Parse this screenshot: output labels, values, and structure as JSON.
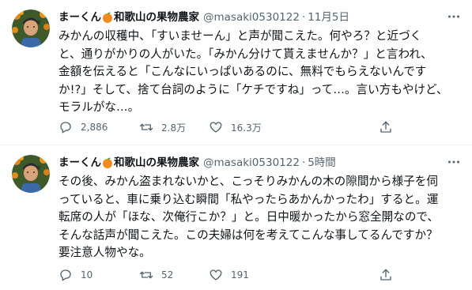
{
  "colors": {
    "text_primary": "#0f1419",
    "text_secondary": "#536471",
    "divider": "#eff3f4",
    "emoji_orange": "#f08a1c"
  },
  "tweets": [
    {
      "display_name": "まーくん",
      "display_name_suffix": "和歌山の果物農家",
      "handle": "@masaki0530122",
      "separator": "·",
      "time": "11月5日",
      "lines": [
        "みかんの収穫中、「すいませーん」と声が聞こえた。何やろ？と近づく",
        "と、通りがかりの人がいた。「みかん分けて貰えませんか？」と言われ、",
        "金額を伝えると「こんなにいっぱいあるのに、無料でもらえないんです",
        "か!?」そして、捨て台詞のように「ケチですね」って…。言い方もやけど、",
        "モラルがな…。"
      ],
      "reply_count": "2,886",
      "retweet_count": "2.8万",
      "like_count": "16.3万",
      "icons": [
        "reply-icon",
        "retweet-icon",
        "like-icon",
        "share-icon",
        "more-icon"
      ]
    },
    {
      "display_name": "まーくん",
      "display_name_suffix": "和歌山の果物農家",
      "handle": "@masaki0530122",
      "separator": "·",
      "time": "5時間",
      "lines": [
        "その後、みかん盗まれないかと、こっそりみかんの木の隙間から様子を伺",
        "っていると、車に乗り込む瞬間「私やったらあかんかったわ」すると。運",
        "転席の人が「ほな、次俺行こか？」と。日中暖かったから窓全開なので、",
        "そんな話声が聞こえた。この夫婦は何を考えてこんな事してるんですか？",
        "要注意人物やな。"
      ],
      "reply_count": "10",
      "retweet_count": "52",
      "like_count": "191",
      "icons": [
        "reply-icon",
        "retweet-icon",
        "like-icon",
        "share-icon",
        "more-icon"
      ]
    }
  ]
}
